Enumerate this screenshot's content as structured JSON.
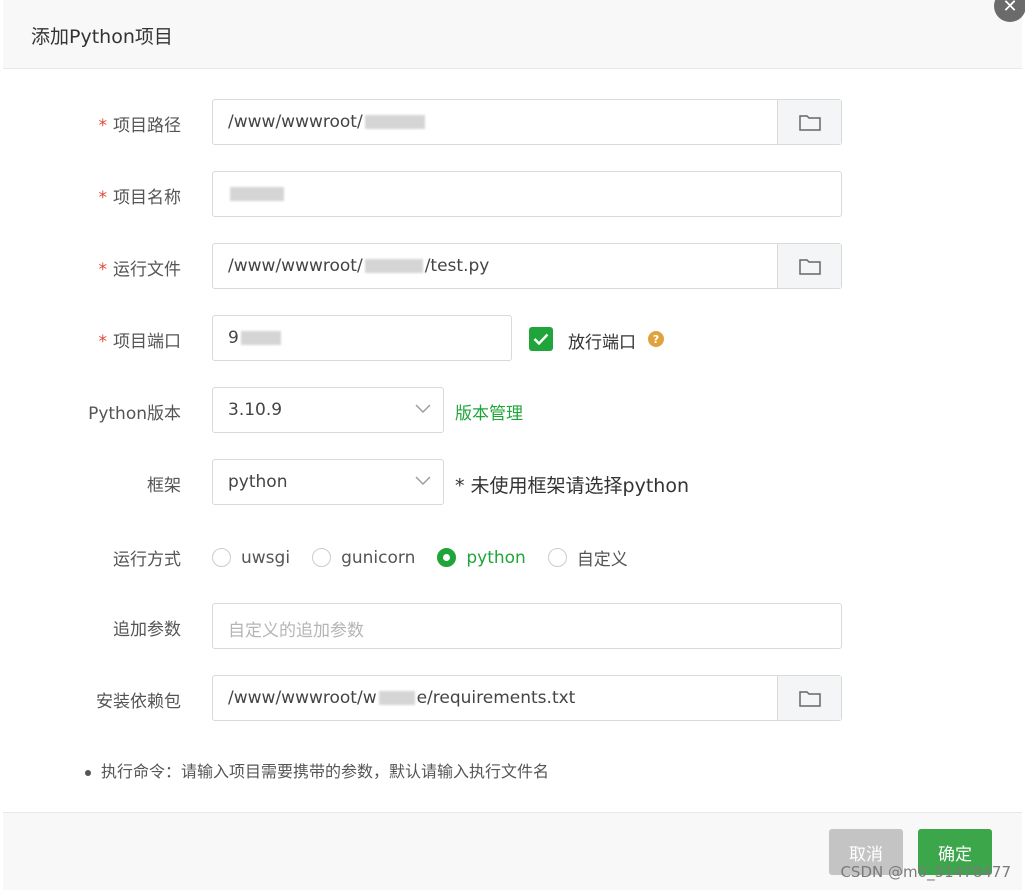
{
  "dialog": {
    "title": "添加Python项目"
  },
  "form": {
    "path": {
      "label": "项目路径",
      "value": "/www/wwwroot/"
    },
    "name": {
      "label": "项目名称",
      "value": ""
    },
    "run_file": {
      "label": "运行文件",
      "value_prefix": "/www/wwwroot/",
      "value_suffix": "/test.py"
    },
    "port": {
      "label": "项目端口",
      "value": "9",
      "open_port_label": "放行端口",
      "open_port_checked": true
    },
    "python_version": {
      "label": "Python版本",
      "value": "3.10.9",
      "manage_link": "版本管理"
    },
    "framework": {
      "label": "框架",
      "value": "python",
      "hint": "* 未使用框架请选择python"
    },
    "run_mode": {
      "label": "运行方式",
      "options": [
        "uwsgi",
        "gunicorn",
        "python",
        "自定义"
      ],
      "selected": "python"
    },
    "extra_args": {
      "label": "追加参数",
      "placeholder": "自定义的追加参数"
    },
    "requirements": {
      "label": "安装依赖包",
      "value_prefix": "/www/wwwroot/w",
      "value_suffix": "e/requirements.txt"
    }
  },
  "note": "执行命令：请输入项目需要携带的参数，默认请输入执行文件名",
  "footer": {
    "cancel_label": "取消",
    "ok_label": "确定"
  },
  "watermark": "CSDN @m0_51478477",
  "colors": {
    "primary": "#20a53a",
    "required": "#e04a3a",
    "help": "#e0a23d"
  }
}
